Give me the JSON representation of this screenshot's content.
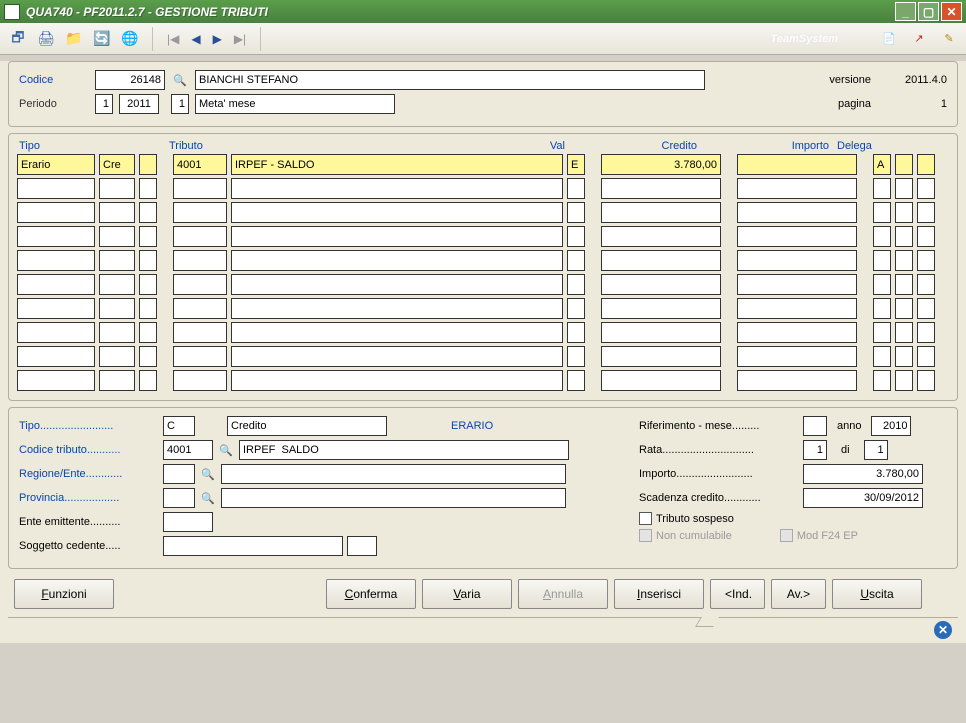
{
  "window": {
    "title": "QUA740  - PF2011.2.7  -  GESTIONE TRIBUTI"
  },
  "toolbar": {
    "brand": "TeamSystem"
  },
  "header": {
    "codice_label": "Codice",
    "codice_value": "26148",
    "nome": "BIANCHI STEFANO",
    "periodo_label": "Periodo",
    "periodo_num": "1",
    "periodo_anno": "2011",
    "periodo_sub": "1",
    "periodo_desc": "Meta' mese",
    "versione_label": "versione",
    "versione_value": "2011.4.0",
    "pagina_label": "pagina",
    "pagina_value": "1"
  },
  "grid": {
    "headers": {
      "tipo": "Tipo",
      "tributo": "Tributo",
      "val": "Val",
      "credito": "Credito",
      "importo": "Importo",
      "delega": "Delega"
    },
    "rows": [
      {
        "tipo1": "Erario",
        "tipo2": "Cre",
        "tipo3": "",
        "trib_code": "4001",
        "trib_desc": "IRPEF - SALDO",
        "val": "E",
        "credito": "3.780,00",
        "importo": "",
        "del1": "A",
        "del2": "",
        "del3": "",
        "hl": true
      },
      {
        "tipo1": "",
        "tipo2": "",
        "tipo3": "",
        "trib_code": "",
        "trib_desc": "",
        "val": "",
        "credito": "",
        "importo": "",
        "del1": "",
        "del2": "",
        "del3": ""
      },
      {
        "tipo1": "",
        "tipo2": "",
        "tipo3": "",
        "trib_code": "",
        "trib_desc": "",
        "val": "",
        "credito": "",
        "importo": "",
        "del1": "",
        "del2": "",
        "del3": ""
      },
      {
        "tipo1": "",
        "tipo2": "",
        "tipo3": "",
        "trib_code": "",
        "trib_desc": "",
        "val": "",
        "credito": "",
        "importo": "",
        "del1": "",
        "del2": "",
        "del3": ""
      },
      {
        "tipo1": "",
        "tipo2": "",
        "tipo3": "",
        "trib_code": "",
        "trib_desc": "",
        "val": "",
        "credito": "",
        "importo": "",
        "del1": "",
        "del2": "",
        "del3": ""
      },
      {
        "tipo1": "",
        "tipo2": "",
        "tipo3": "",
        "trib_code": "",
        "trib_desc": "",
        "val": "",
        "credito": "",
        "importo": "",
        "del1": "",
        "del2": "",
        "del3": ""
      },
      {
        "tipo1": "",
        "tipo2": "",
        "tipo3": "",
        "trib_code": "",
        "trib_desc": "",
        "val": "",
        "credito": "",
        "importo": "",
        "del1": "",
        "del2": "",
        "del3": ""
      },
      {
        "tipo1": "",
        "tipo2": "",
        "tipo3": "",
        "trib_code": "",
        "trib_desc": "",
        "val": "",
        "credito": "",
        "importo": "",
        "del1": "",
        "del2": "",
        "del3": ""
      },
      {
        "tipo1": "",
        "tipo2": "",
        "tipo3": "",
        "trib_code": "",
        "trib_desc": "",
        "val": "",
        "credito": "",
        "importo": "",
        "del1": "",
        "del2": "",
        "del3": ""
      },
      {
        "tipo1": "",
        "tipo2": "",
        "tipo3": "",
        "trib_code": "",
        "trib_desc": "",
        "val": "",
        "credito": "",
        "importo": "",
        "del1": "",
        "del2": "",
        "del3": ""
      }
    ]
  },
  "detail": {
    "tipo_label": "Tipo........................",
    "tipo_code": "C",
    "tipo_desc": "Credito",
    "tipo_cat": "ERARIO",
    "codice_trib_label": "Codice tributo...........",
    "codice_trib_value": "4001",
    "codice_trib_desc": "IRPEF  SALDO",
    "regione_label": "Regione/Ente............",
    "regione_value": "",
    "regione_desc": "",
    "provincia_label": "Provincia..................",
    "provincia_value": "",
    "provincia_desc": "",
    "ente_label": "Ente emittente..........",
    "ente_value": "",
    "sogg_label": "Soggetto cedente.....",
    "sogg_value": "",
    "sogg_extra": "",
    "rif_label": "Riferimento - mese.........",
    "rif_mese": "",
    "anno_label": "anno",
    "rif_anno": "2010",
    "rata_label": "Rata..............................",
    "rata_num": "1",
    "rata_di": "di",
    "rata_tot": "1",
    "importo_label": "Importo.........................",
    "importo_value": "3.780,00",
    "scadenza_label": "Scadenza credito............",
    "scadenza_value": "30/09/2012",
    "chk_sospeso": "Tributo sospeso",
    "chk_noncum": "Non cumulabile",
    "chk_modf24": "Mod F24 EP"
  },
  "buttons": {
    "funzioni": "Funzioni",
    "conferma": "Conferma",
    "varia": "Varia",
    "annulla": "Annulla",
    "inserisci": "Inserisci",
    "ind": "<Ind.",
    "av": "Av.>",
    "uscita": "Uscita"
  }
}
